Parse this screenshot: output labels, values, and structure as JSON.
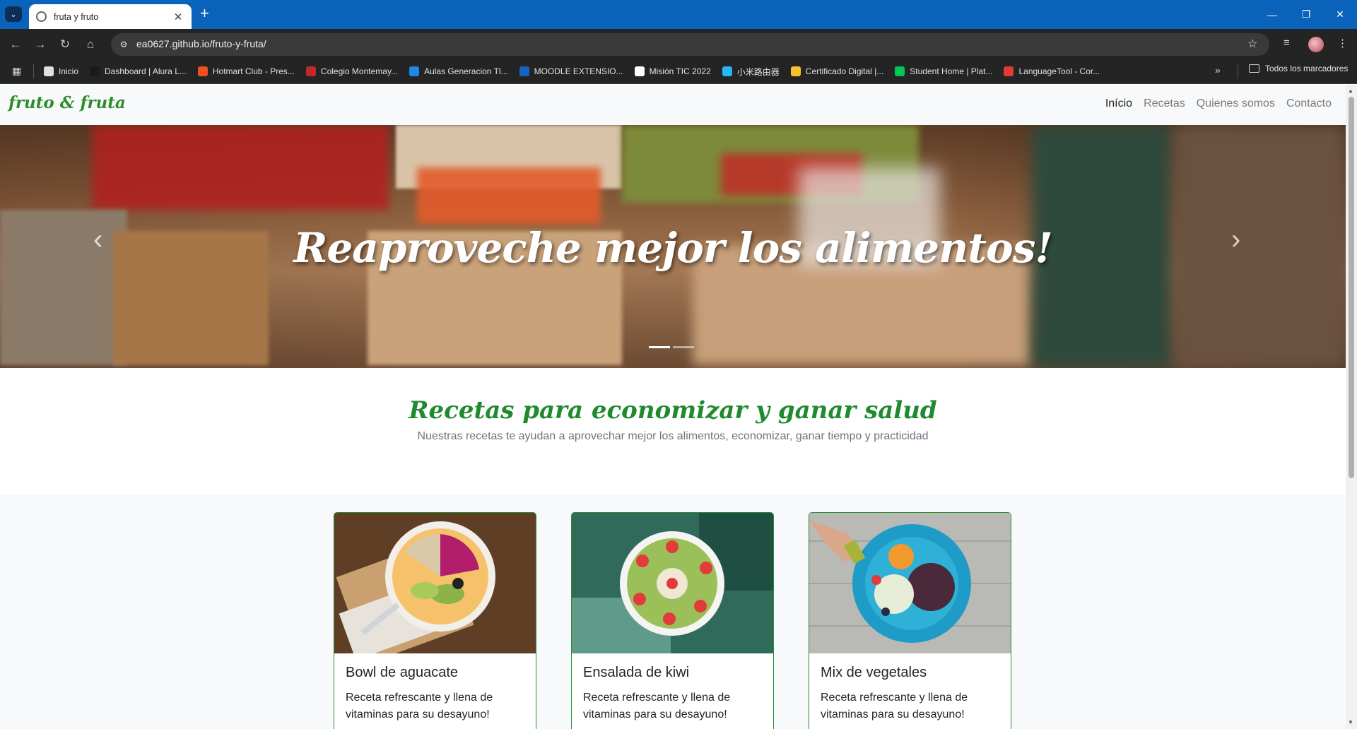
{
  "browser": {
    "tab_title": "fruta y fruto",
    "url": "ea0627.github.io/fruto-y-fruta/",
    "bookmarks": [
      {
        "label": "Inicio",
        "color": "#e0e0e0"
      },
      {
        "label": "Dashboard | Alura L...",
        "color": "#1a1a1a"
      },
      {
        "label": "Hotmart Club - Pres...",
        "color": "#f04e23"
      },
      {
        "label": "Colegio Montemay...",
        "color": "#c62828"
      },
      {
        "label": "Aulas Generacion Tl...",
        "color": "#1e88e5"
      },
      {
        "label": "MOODLE EXTENSIO...",
        "color": "#1565c0"
      },
      {
        "label": "Misión TIC 2022",
        "color": "#ffffff"
      },
      {
        "label": "小米路由器",
        "color": "#29b6f6"
      },
      {
        "label": "Certificado Digital |...",
        "color": "#fbc02d"
      },
      {
        "label": "Student Home | Plat...",
        "color": "#00c853"
      },
      {
        "label": "LanguageTool - Cor...",
        "color": "#e53935"
      }
    ],
    "bookmarks_folder": "Todos los marcadores"
  },
  "site": {
    "brand": "fruto & fruta",
    "nav": [
      "Início",
      "Recetas",
      "Quienes somos",
      "Contacto"
    ],
    "hero_title": "Reaproveche mejor los alimentos!",
    "carousel_slides": 2,
    "carousel_active": 1,
    "section_title": "Recetas para economizar y ganar salud",
    "section_subtitle": "Nuestras recetas te ayudan a aprovechar mejor los alimentos, economizar, ganar tiempo y practicidad",
    "cards": [
      {
        "title": "Bowl de aguacate",
        "text": "Receta refrescante y llena de vitaminas para su desayuno!"
      },
      {
        "title": "Ensalada de kiwi",
        "text": "Receta refrescante y llena de vitaminas para su desayuno!"
      },
      {
        "title": "Mix de vegetales",
        "text": "Receta refrescante y llena de vitaminas para su desayuno!"
      }
    ],
    "brand_color": "#2e8b2e"
  }
}
